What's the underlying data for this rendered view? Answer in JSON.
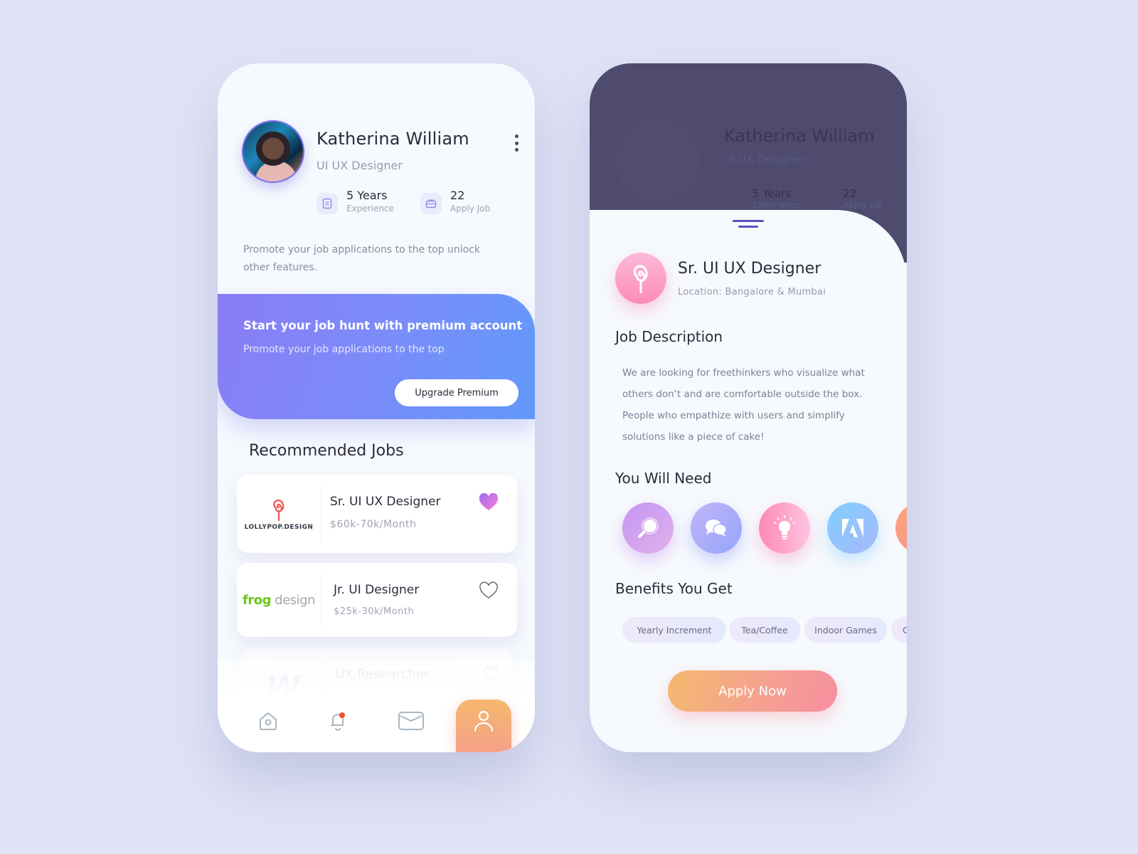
{
  "profile": {
    "name": "Katherina William",
    "role": "UI UX Designer",
    "stats": [
      {
        "value": "5 Years",
        "label": "Experience",
        "icon": "document-icon"
      },
      {
        "value": "22",
        "label": "Apply Job",
        "icon": "briefcase-icon"
      }
    ],
    "promo_text": "Promote your job applications to the top unlock other features."
  },
  "premium": {
    "title": "Start your job hunt with premium account",
    "subtitle": "Promote your job applications to the top",
    "button_label": "Upgrade Premium"
  },
  "recommended": {
    "title": "Recommended Jobs",
    "jobs": [
      {
        "company": "LOLLYPOP.DESIGN",
        "title": "Sr. UI UX Designer",
        "salary": "$60k-70k/Month",
        "favorited": true
      },
      {
        "company_part1": "frog",
        "company_part2": "design",
        "title": "Jr. UI Designer",
        "salary": "$25k-30k/Month",
        "favorited": false
      },
      {
        "company": "W",
        "title": "UX Researcher",
        "salary": "",
        "favorited": false
      }
    ]
  },
  "nav": {
    "items": [
      "home",
      "notifications",
      "messages",
      "profile"
    ],
    "active": "profile",
    "notification_dot": true
  },
  "detail": {
    "job_title": "Sr. UI UX Designer",
    "location": "Location: Bangalore & Mumbai",
    "description_heading": "Job Description",
    "description": "We are looking for freethinkers who visualize what others don’t and are comfortable outside the box. People who empathize with users and simplify solutions like a piece of cake!",
    "needs_heading": "You Will Need",
    "skills": [
      "research-magnifier",
      "communication-chat",
      "ideas-lightbulb",
      "adobe",
      "more"
    ],
    "benefits_heading": "Benefits You Get",
    "benefits": [
      "Yearly Increment",
      "Tea/Coffee",
      "Indoor Games",
      "G"
    ],
    "apply_label": "Apply Now"
  },
  "colors": {
    "background": "#e0e3f6",
    "premium_gradient_start": "#8a7cf6",
    "premium_gradient_end": "#6299fa",
    "accent_orange": "#f5b76c",
    "accent_pink": "#fd8cb4",
    "dark_header": "#4e4b6f"
  }
}
